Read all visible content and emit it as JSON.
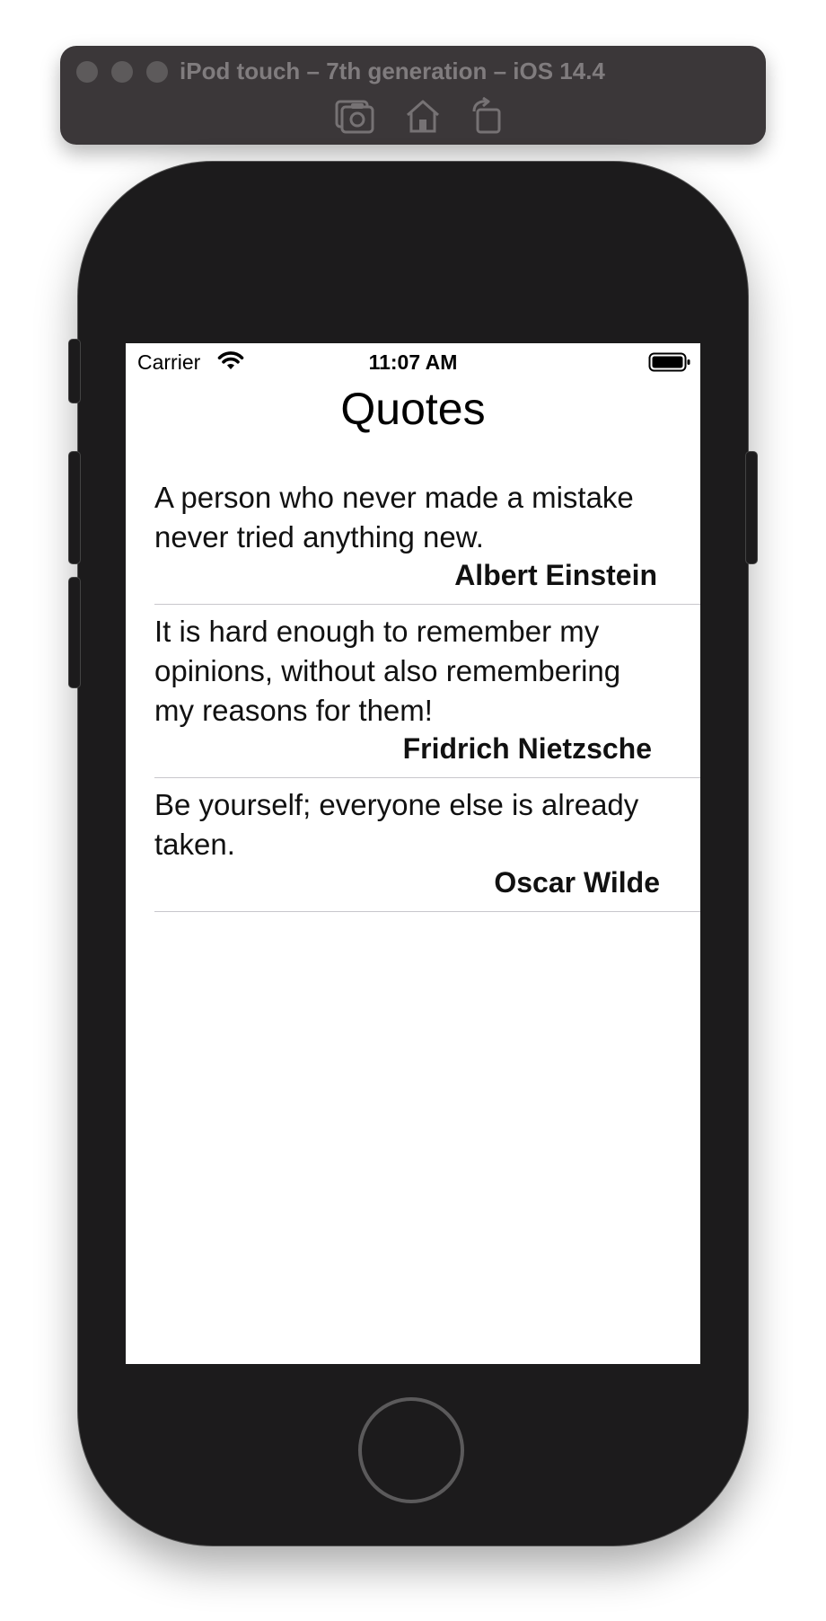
{
  "simulator": {
    "title": "iPod touch – 7th generation – iOS 14.4",
    "toolbar": [
      {
        "icon": "screenshot-camera-icon"
      },
      {
        "icon": "home-icon"
      },
      {
        "icon": "rotate-icon"
      }
    ]
  },
  "status_bar": {
    "carrier": "Carrier",
    "time": "11:07 AM",
    "wifi_icon": "wifi-icon",
    "battery_icon": "battery-full-icon"
  },
  "nav": {
    "title": "Quotes"
  },
  "quotes": [
    {
      "text": "A person who never made a mistake never tried anything new.",
      "author": "Albert Einstein"
    },
    {
      "text": "It is hard enough to remember my opinions, without also remembering my reasons for them!",
      "author": "Fridrich Nietzsche"
    },
    {
      "text": "Be yourself; everyone else is already taken.",
      "author": "Oscar Wilde"
    }
  ],
  "colors": {
    "device_body": "#1c1b1c",
    "simulator_bar": "#3b3739",
    "separator": "#c8c7cc"
  }
}
